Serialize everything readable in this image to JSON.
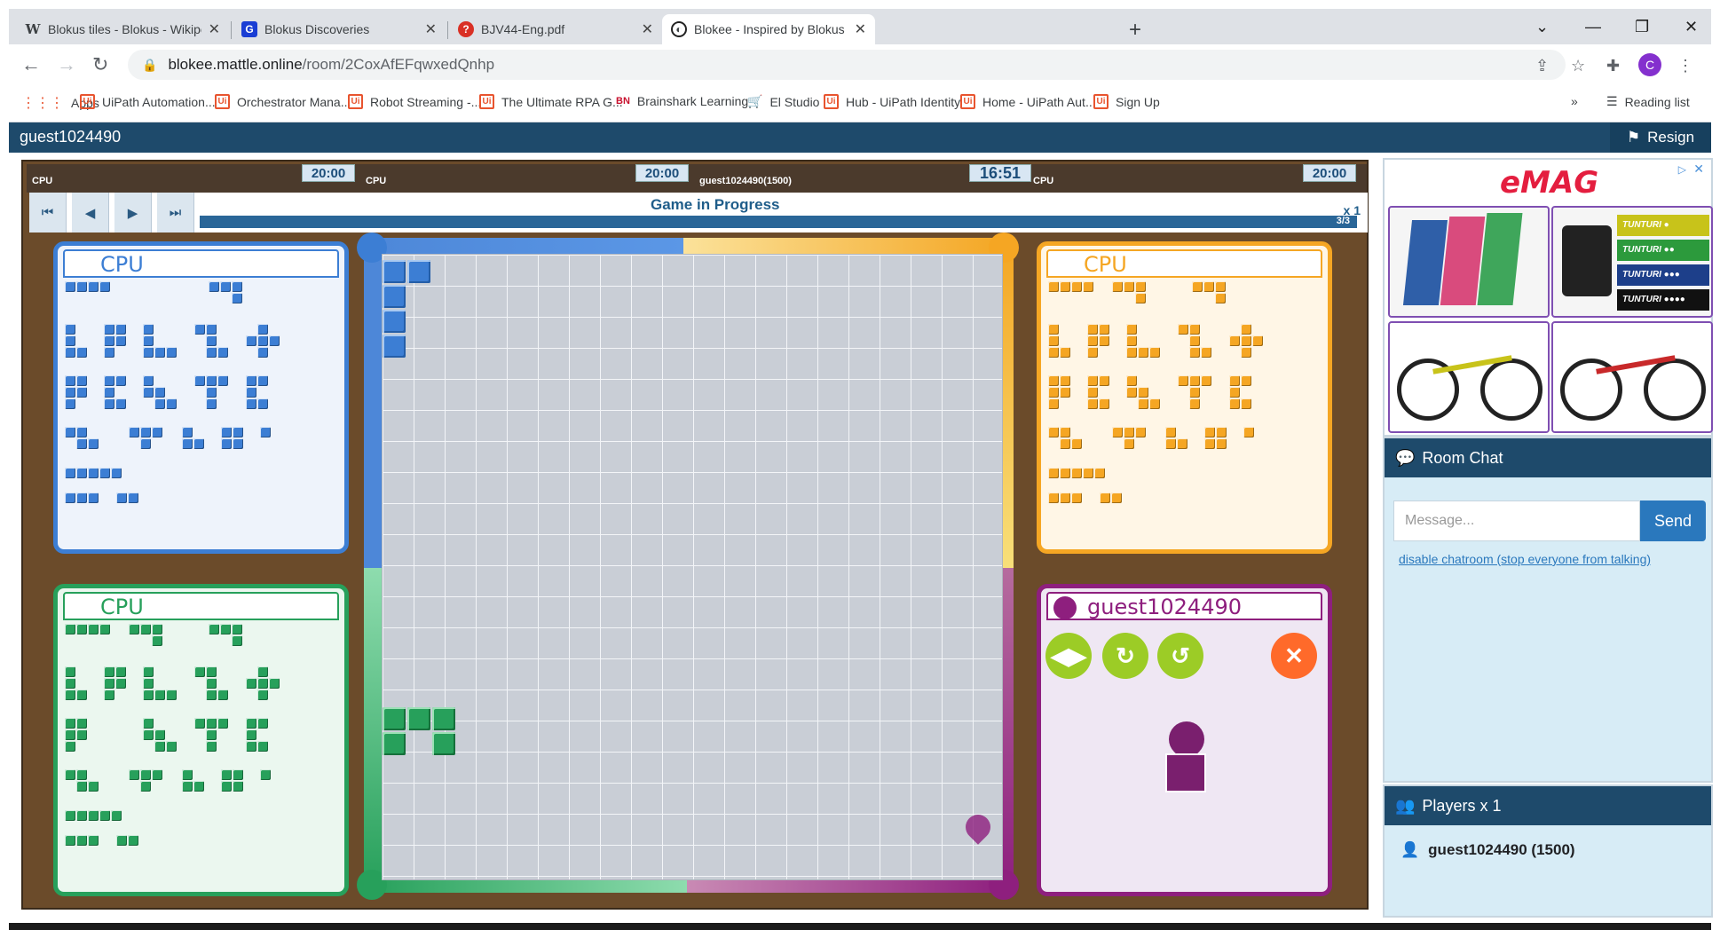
{
  "browser": {
    "tabs": [
      {
        "title": "Blokus tiles - Blokus - Wikipedia",
        "favicon": "W",
        "active": false
      },
      {
        "title": "Blokus Discoveries",
        "favicon": "G",
        "active": false
      },
      {
        "title": "BJV44-Eng.pdf",
        "favicon": "?",
        "active": false
      },
      {
        "title": "Blokee - Inspired by Blokus - Onl",
        "favicon": "◐",
        "active": true
      }
    ],
    "url_host": "blokee.mattle.online",
    "url_path": "/room/2CoxAfEFqwxedQnhp",
    "profile_initial": "C",
    "bookmarks": [
      {
        "label": "Apps",
        "icon": "apps-icon"
      },
      {
        "label": "UiPath Automation...",
        "icon": "uipath-icon"
      },
      {
        "label": "Orchestrator Mana...",
        "icon": "uipath-icon"
      },
      {
        "label": "Robot Streaming -...",
        "icon": "uipath-icon"
      },
      {
        "label": "The Ultimate RPA G...",
        "icon": "uipath-icon"
      },
      {
        "label": "Brainshark Learning",
        "icon": "brainshark-icon"
      },
      {
        "label": "El Studio",
        "icon": "studio-icon"
      },
      {
        "label": "Hub - UiPath Identity",
        "icon": "uipath-icon"
      },
      {
        "label": "Home - UiPath Aut...",
        "icon": "uipath-icon"
      },
      {
        "label": "Sign Up",
        "icon": "uipath-icon"
      }
    ],
    "more_bookmarks": "»",
    "reading_list": "Reading list"
  },
  "app": {
    "username": "guest1024490",
    "resign_label": "Resign"
  },
  "game": {
    "players": [
      {
        "label": "CPU",
        "clock": "20:00"
      },
      {
        "label": "CPU",
        "clock": "20:00"
      },
      {
        "label": "guest1024490(1500)",
        "clock": "16:51"
      },
      {
        "label": "CPU",
        "clock": "20:00"
      }
    ],
    "status": "Game in Progress",
    "progress": "3/3",
    "speed": "x 1",
    "panels": {
      "blue": "CPU",
      "orange": "CPU",
      "green": "CPU",
      "purple": "guest1024490"
    },
    "colors": {
      "blue": "#3c7ed4",
      "orange": "#f5a623",
      "green": "#27a05b",
      "purple": "#8e1f7e"
    }
  },
  "sidebar": {
    "ad_brand": "eMAG",
    "ad_product_labels": [
      "TUNTURI ●",
      "TUNTURI ●●",
      "TUNTURI ●●●",
      "TUNTURI ●●●●"
    ],
    "room_chat_title": "Room Chat",
    "message_placeholder": "Message...",
    "send_label": "Send",
    "disable_chat_link": "disable chatroom (stop everyone from talking)",
    "players_title": "Players x 1",
    "player_entry": "guest1024490 (1500)"
  }
}
